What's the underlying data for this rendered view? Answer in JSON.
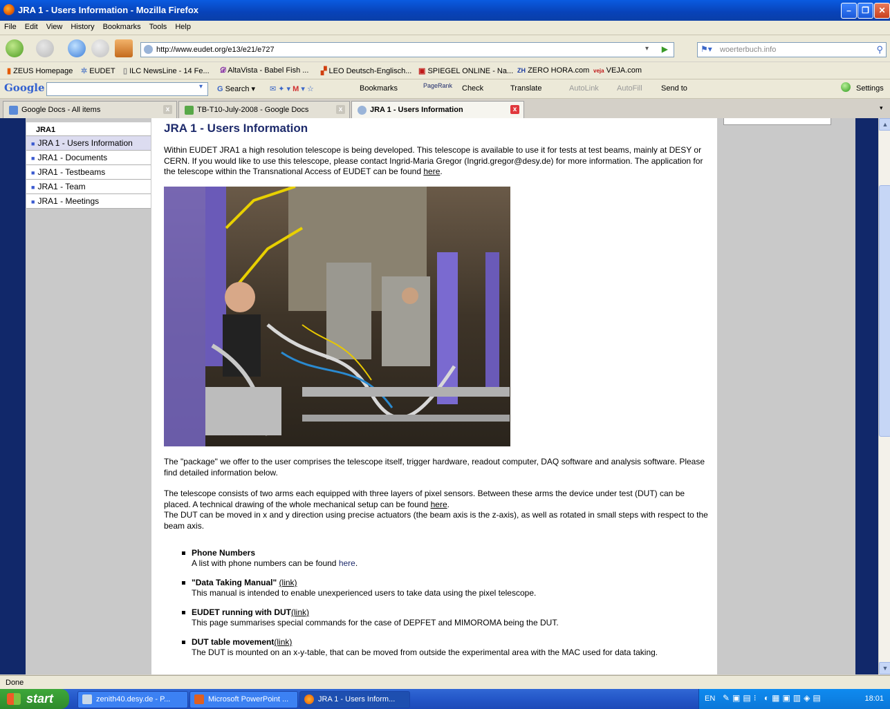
{
  "window": {
    "title": "JRA 1 - Users Information - Mozilla Firefox",
    "min": "–",
    "max": "❐",
    "close": "✕"
  },
  "menu": [
    "File",
    "Edit",
    "View",
    "History",
    "Bookmarks",
    "Tools",
    "Help"
  ],
  "nav": {
    "url": "http://www.eudet.org/e13/e21/e727",
    "search_placeholder": "woerterbuch.info"
  },
  "bookmarks": [
    "ZEUS Homepage",
    "EUDET",
    "ILC NewsLine - 14 Fe...",
    "AltaVista - Babel Fish ...",
    "LEO Deutsch-Englisch...",
    "SPIEGEL ONLINE - Na...",
    "ZERO HORA.com",
    "VEJA.com"
  ],
  "google_toolbar": {
    "logo": "Google",
    "search": "Search",
    "bookmarks": "Bookmarks",
    "pagerank": "PageRank",
    "check": "Check",
    "translate": "Translate",
    "autolink": "AutoLink",
    "autofill": "AutoFill",
    "sendto": "Send to",
    "settings": "Settings"
  },
  "tabs": [
    {
      "label": "Google Docs - All items"
    },
    {
      "label": "TB-T10-July-2008 - Google Docs"
    },
    {
      "label": "JRA 1 - Users Information"
    }
  ],
  "sidebar": {
    "heading": "JRA1",
    "items": [
      {
        "label": "JRA 1 - Users Information"
      },
      {
        "label": "JRA1 - Documents"
      },
      {
        "label": "JRA1 - Testbeams"
      },
      {
        "label": "JRA1 - Team"
      },
      {
        "label": "JRA1 - Meetings"
      }
    ]
  },
  "content": {
    "title": "JRA 1 - Users Information",
    "intro": "Within EUDET JRA1 a high resolution telescope is being developed. This telescope is available to use it for tests at test beams, mainly at DESY or CERN. If you would like to use this telescope, please contact Ingrid-Maria Gregor (Ingrid.gregor@desy.de) for more information. The application for the telescope within the Transnational Access of EUDET can be found ",
    "intro_link": "here",
    "intro_end": ".",
    "package": "The \"package\" we offer to the user comprises the telescope itself, trigger hardware, readout computer, DAQ software and analysis software. Please find detailed information below.",
    "arms": "The telescope consists of two arms each equipped with three layers of pixel sensors. Between these arms the device under test (DUT) can be placed. A technical drawing of the whole mechanical setup can be found ",
    "arms_link": "here",
    "arms_end": ".",
    "dut_move": "The DUT can be moved in x and y direction using precise actuators (the beam axis is the z-axis), as well as rotated in small steps with respect to the beam axis.",
    "list": [
      {
        "title": "Phone Numbers",
        "link": "",
        "desc_pre": "A list with phone numbers can be found ",
        "desc_link": "here",
        "desc_post": "."
      },
      {
        "title": "\"Data Taking Manual\"",
        "link": "(link)",
        "desc_pre": "This manual is intended to enable unexperienced users to take data using the pixel telescope.",
        "desc_link": "",
        "desc_post": ""
      },
      {
        "title": "EUDET running with DUT",
        "link": "(link)",
        "desc_pre": "This page summarises special commands for the case of DEPFET and MIMOROMA being the DUT.",
        "desc_link": "",
        "desc_post": ""
      },
      {
        "title": "DUT table movement",
        "link": "(link)",
        "desc_pre": "The DUT is mounted on an x-y-table, that can be moved from outside the experimental area with the MAC used for data taking.",
        "desc_link": "",
        "desc_post": ""
      }
    ]
  },
  "status": {
    "text": "Done"
  },
  "taskbar": {
    "start": "start",
    "buttons": [
      {
        "label": "zenith40.desy.de - P..."
      },
      {
        "label": "Microsoft PowerPoint ..."
      },
      {
        "label": "JRA 1 - Users Inform..."
      }
    ],
    "lang": "EN",
    "clock": "18:01"
  }
}
